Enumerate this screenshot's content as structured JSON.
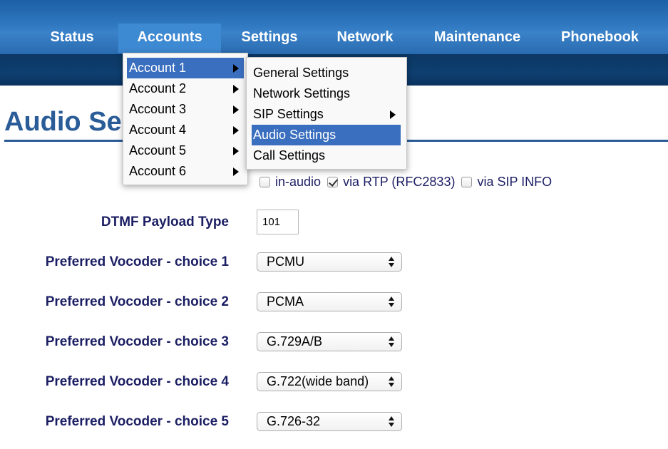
{
  "nav": {
    "items": [
      {
        "label": "Status"
      },
      {
        "label": "Accounts"
      },
      {
        "label": "Settings"
      },
      {
        "label": "Network"
      },
      {
        "label": "Maintenance"
      },
      {
        "label": "Phonebook"
      }
    ],
    "active": "Accounts"
  },
  "page": {
    "title": "Audio Se"
  },
  "accounts_menu": {
    "items": [
      "Account 1",
      "Account 2",
      "Account 3",
      "Account 4",
      "Account 5",
      "Account 6"
    ],
    "highlighted": "Account 1"
  },
  "account_submenu": {
    "items": [
      "General Settings",
      "Network Settings",
      "SIP Settings",
      "Audio Settings",
      "Call Settings"
    ],
    "highlighted": "Audio Settings"
  },
  "form": {
    "dtmf_options": [
      {
        "label": "in-audio",
        "checked": false
      },
      {
        "label": "via RTP (RFC2833)",
        "checked": true
      },
      {
        "label": "via SIP INFO",
        "checked": false
      }
    ],
    "dtmf_payload_label": "DTMF Payload Type",
    "dtmf_payload_value": "101",
    "vocoders": [
      {
        "label": "Preferred Vocoder - choice 1",
        "value": "PCMU"
      },
      {
        "label": "Preferred Vocoder - choice 2",
        "value": "PCMA"
      },
      {
        "label": "Preferred Vocoder - choice 3",
        "value": "G.729A/B"
      },
      {
        "label": "Preferred Vocoder - choice 4",
        "value": "G.722(wide band)"
      },
      {
        "label": "Preferred Vocoder - choice 5",
        "value": "G.726-32"
      }
    ]
  },
  "colors": {
    "nav_active": "#3d89d2",
    "menu_highlight": "#3a6ebe",
    "label_text": "#1b1e63",
    "title_text": "#2a5c98"
  }
}
